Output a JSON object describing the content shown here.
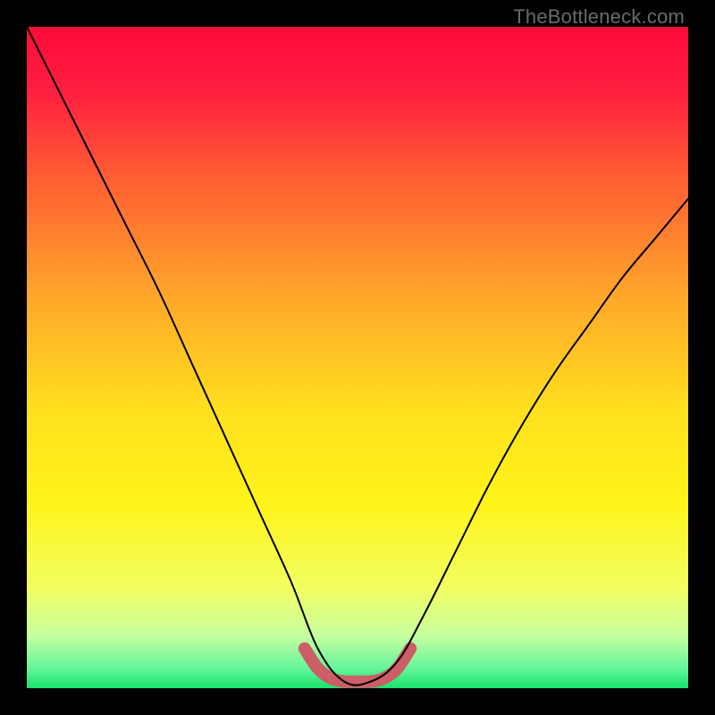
{
  "watermark": "TheBottleneck.com",
  "chart_data": {
    "type": "line",
    "title": "",
    "xlabel": "",
    "ylabel": "",
    "xlim": [
      0,
      100
    ],
    "ylim": [
      0,
      100
    ],
    "grid": false,
    "legend": false,
    "series": [
      {
        "name": "bottleneck-curve",
        "x": [
          0,
          5,
          10,
          15,
          20,
          25,
          30,
          35,
          40,
          44,
          48,
          52,
          56,
          60,
          65,
          70,
          75,
          80,
          85,
          90,
          95,
          100
        ],
        "values": [
          100,
          90,
          80,
          70,
          60,
          49,
          38,
          27,
          16,
          6,
          1,
          1,
          4,
          11,
          21,
          31,
          40,
          48,
          55,
          62,
          68,
          74
        ]
      },
      {
        "name": "bottleneck-floor-highlight",
        "x": [
          42,
          44,
          46,
          48,
          50,
          52,
          54,
          56,
          58
        ],
        "values": [
          6,
          3,
          1.5,
          1,
          1,
          1,
          1.5,
          3,
          6
        ]
      }
    ],
    "gradient_stops": [
      {
        "offset": 0.0,
        "color": "#ff0a3a"
      },
      {
        "offset": 0.1,
        "color": "#ff1f3f"
      },
      {
        "offset": 0.22,
        "color": "#ff5a33"
      },
      {
        "offset": 0.4,
        "color": "#ffa42a"
      },
      {
        "offset": 0.58,
        "color": "#ffe01e"
      },
      {
        "offset": 0.72,
        "color": "#fff419"
      },
      {
        "offset": 0.85,
        "color": "#f2ff62"
      },
      {
        "offset": 0.92,
        "color": "#c7ffa0"
      },
      {
        "offset": 0.97,
        "color": "#64f59a"
      },
      {
        "offset": 1.0,
        "color": "#19e36e"
      }
    ],
    "colors": {
      "curve": "#000000",
      "highlight": "#cc5e66",
      "background_frame": "#000000"
    }
  }
}
